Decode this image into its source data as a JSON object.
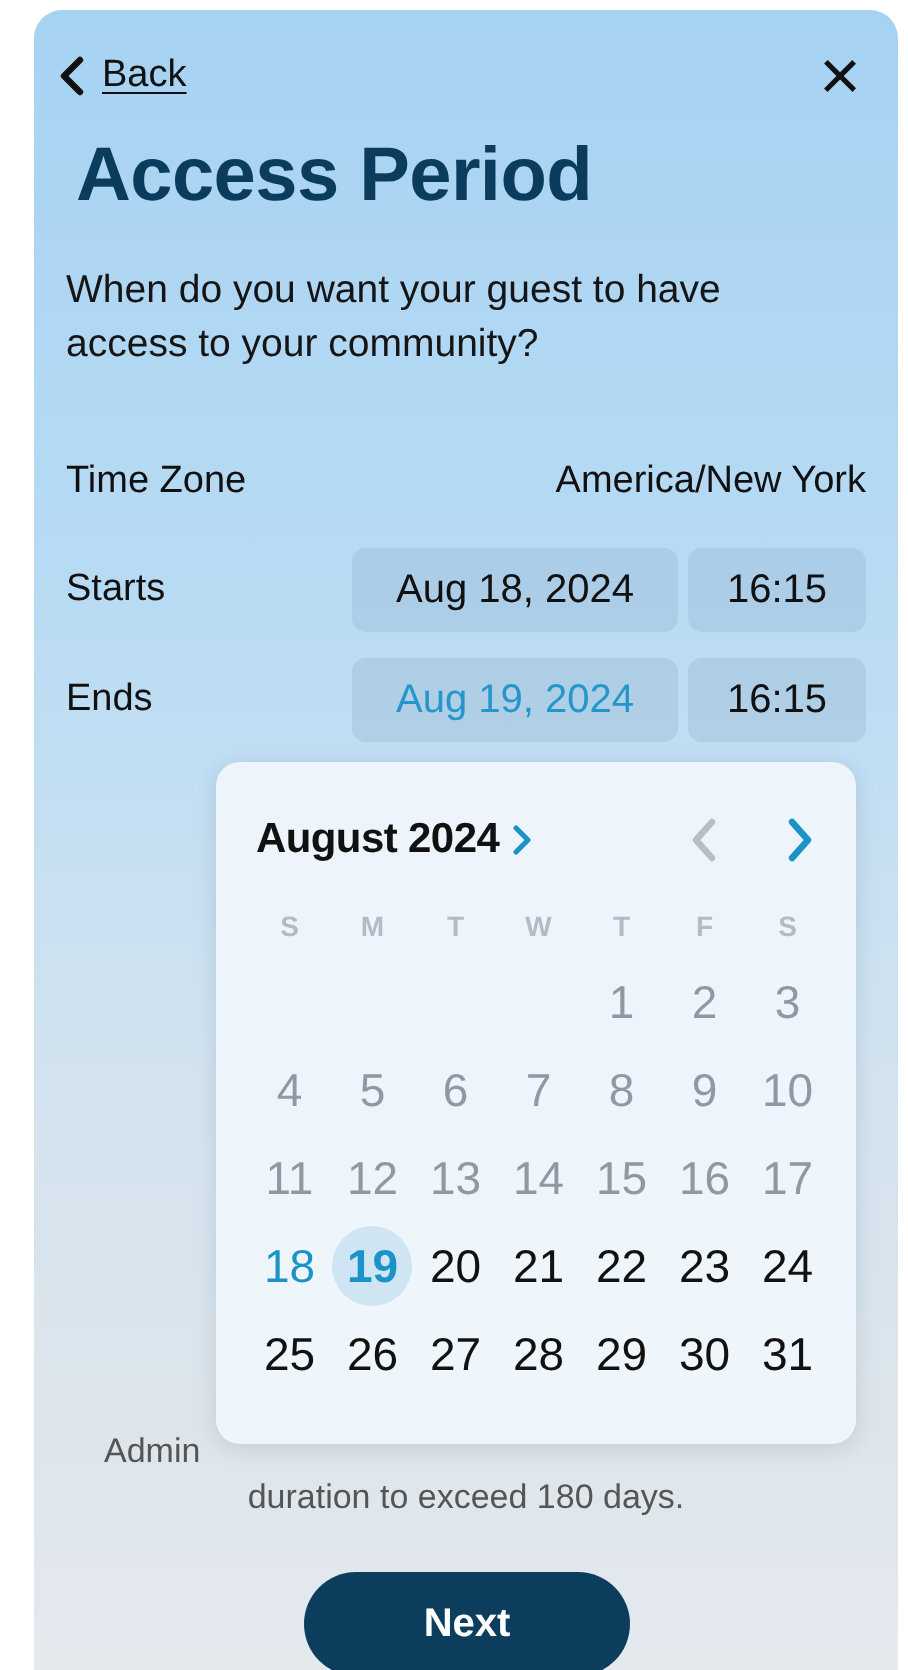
{
  "nav": {
    "back": "Back",
    "close_glyph": "×"
  },
  "title": "Access Period",
  "question": "When do you want your guest to have access to your community?",
  "time_zone": {
    "label": "Time Zone",
    "value": "America/New York"
  },
  "rows": [
    {
      "label": "Starts",
      "date": "Aug 18, 2024",
      "time": "16:15",
      "active": false
    },
    {
      "label": "Ends",
      "date": "Aug 19, 2024",
      "time": "16:15",
      "active": true
    }
  ],
  "calendar": {
    "month": "August 2024",
    "prev_disabled": true,
    "next_disabled": false,
    "weekdays": [
      "S",
      "M",
      "T",
      "W",
      "T",
      "F",
      "S"
    ],
    "days": [
      {
        "kind": "blank"
      },
      {
        "kind": "blank"
      },
      {
        "kind": "blank"
      },
      {
        "kind": "blank"
      },
      {
        "kind": "day",
        "label": "1",
        "disabled": true,
        "selected": false,
        "start": false
      },
      {
        "kind": "day",
        "label": "2",
        "disabled": true,
        "selected": false,
        "start": false
      },
      {
        "kind": "day",
        "label": "3",
        "disabled": true,
        "selected": false,
        "start": false
      },
      {
        "kind": "day",
        "label": "4",
        "disabled": true,
        "selected": false,
        "start": false
      },
      {
        "kind": "day",
        "label": "5",
        "disabled": true,
        "selected": false,
        "start": false
      },
      {
        "kind": "day",
        "label": "6",
        "disabled": true,
        "selected": false,
        "start": false
      },
      {
        "kind": "day",
        "label": "7",
        "disabled": true,
        "selected": false,
        "start": false
      },
      {
        "kind": "day",
        "label": "8",
        "disabled": true,
        "selected": false,
        "start": false
      },
      {
        "kind": "day",
        "label": "9",
        "disabled": true,
        "selected": false,
        "start": false
      },
      {
        "kind": "day",
        "label": "10",
        "disabled": true,
        "selected": false,
        "start": false
      },
      {
        "kind": "day",
        "label": "11",
        "disabled": true,
        "selected": false,
        "start": false
      },
      {
        "kind": "day",
        "label": "12",
        "disabled": true,
        "selected": false,
        "start": false
      },
      {
        "kind": "day",
        "label": "13",
        "disabled": true,
        "selected": false,
        "start": false
      },
      {
        "kind": "day",
        "label": "14",
        "disabled": true,
        "selected": false,
        "start": false
      },
      {
        "kind": "day",
        "label": "15",
        "disabled": true,
        "selected": false,
        "start": false
      },
      {
        "kind": "day",
        "label": "16",
        "disabled": true,
        "selected": false,
        "start": false
      },
      {
        "kind": "day",
        "label": "17",
        "disabled": true,
        "selected": false,
        "start": false
      },
      {
        "kind": "day",
        "label": "18",
        "disabled": false,
        "selected": false,
        "start": true
      },
      {
        "kind": "day",
        "label": "19",
        "disabled": false,
        "selected": true,
        "start": false
      },
      {
        "kind": "day",
        "label": "20",
        "disabled": false,
        "selected": false,
        "start": false
      },
      {
        "kind": "day",
        "label": "21",
        "disabled": false,
        "selected": false,
        "start": false
      },
      {
        "kind": "day",
        "label": "22",
        "disabled": false,
        "selected": false,
        "start": false
      },
      {
        "kind": "day",
        "label": "23",
        "disabled": false,
        "selected": false,
        "start": false
      },
      {
        "kind": "day",
        "label": "24",
        "disabled": false,
        "selected": false,
        "start": false
      },
      {
        "kind": "day",
        "label": "25",
        "disabled": false,
        "selected": false,
        "start": false
      },
      {
        "kind": "day",
        "label": "26",
        "disabled": false,
        "selected": false,
        "start": false
      },
      {
        "kind": "day",
        "label": "27",
        "disabled": false,
        "selected": false,
        "start": false
      },
      {
        "kind": "day",
        "label": "28",
        "disabled": false,
        "selected": false,
        "start": false
      },
      {
        "kind": "day",
        "label": "29",
        "disabled": false,
        "selected": false,
        "start": false
      },
      {
        "kind": "day",
        "label": "30",
        "disabled": false,
        "selected": false,
        "start": false
      },
      {
        "kind": "day",
        "label": "31",
        "disabled": false,
        "selected": false,
        "start": false
      }
    ]
  },
  "note": {
    "line_1_visible": "Admin",
    "line_2": "duration to exceed 180 days."
  },
  "next_button": "Next"
}
